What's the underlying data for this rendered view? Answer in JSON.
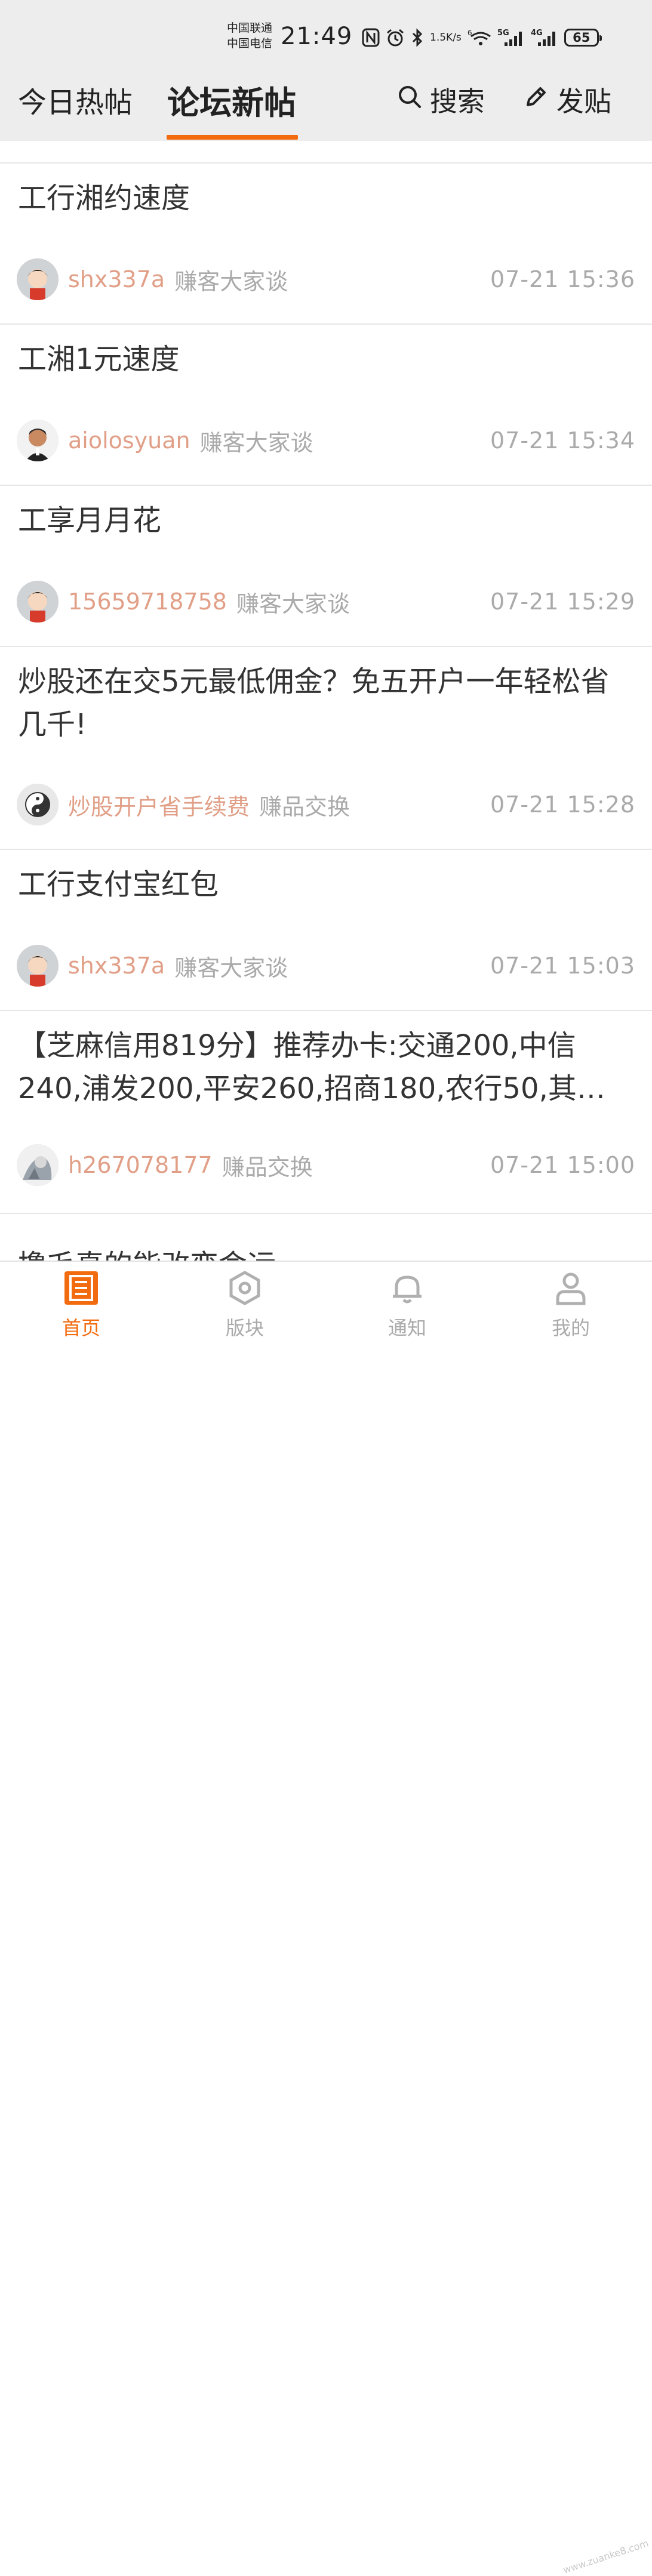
{
  "status_bar": {
    "carrier_1": "中国联通",
    "carrier_2": "中国电信",
    "time": "21:49",
    "net_speed_value": "1.5",
    "net_speed_unit": "K/s",
    "battery": "65",
    "icons": [
      "nfc-icon",
      "alarm-icon",
      "bluetooth-icon",
      "wifi-icon",
      "signal-5g-icon",
      "signal-4g-icon",
      "battery-icon"
    ]
  },
  "header": {
    "tabs": [
      {
        "label": "今日热帖",
        "active": false
      },
      {
        "label": "论坛新帖",
        "active": true
      }
    ],
    "search_label": "搜索",
    "post_label": "发贴",
    "accent": "#f26b0f"
  },
  "posts": [
    {
      "title": "工行湘约速度",
      "author": "shx337a",
      "forum": "赚客大家谈",
      "time": "07-21 15:36"
    },
    {
      "title": "工湘1元速度",
      "author": "aiolosyuan",
      "forum": "赚客大家谈",
      "time": "07-21 15:34"
    },
    {
      "title": "工享月月花",
      "author": "15659718758",
      "forum": "赚客大家谈",
      "time": "07-21 15:29"
    },
    {
      "title": "炒股还在交5元最低佣金？免五开户一年轻松省几千!",
      "author": "炒股开户省手续费",
      "forum": "赚品交换",
      "time": "07-21 15:28"
    },
    {
      "title": "工行支付宝红包",
      "author": "shx337a",
      "forum": "赚客大家谈",
      "time": "07-21 15:03"
    },
    {
      "title": "【芝麻信用819分】推荐办卡:交通200,中信240,浦发200,平安260,招商180,农行50,其…",
      "author": "h267078177",
      "forum": "赚品交换",
      "time": "07-21 15:00"
    }
  ],
  "partial_post_title": "撸毛真的能改变命运",
  "bottom_nav": [
    {
      "label": "首页",
      "icon": "home-list-icon",
      "active": true
    },
    {
      "label": "版块",
      "icon": "board-hexagon-icon",
      "active": false
    },
    {
      "label": "通知",
      "icon": "bell-icon",
      "active": false
    },
    {
      "label": "我的",
      "icon": "user-icon",
      "active": false
    }
  ],
  "watermark": "www.zuanke8.com"
}
